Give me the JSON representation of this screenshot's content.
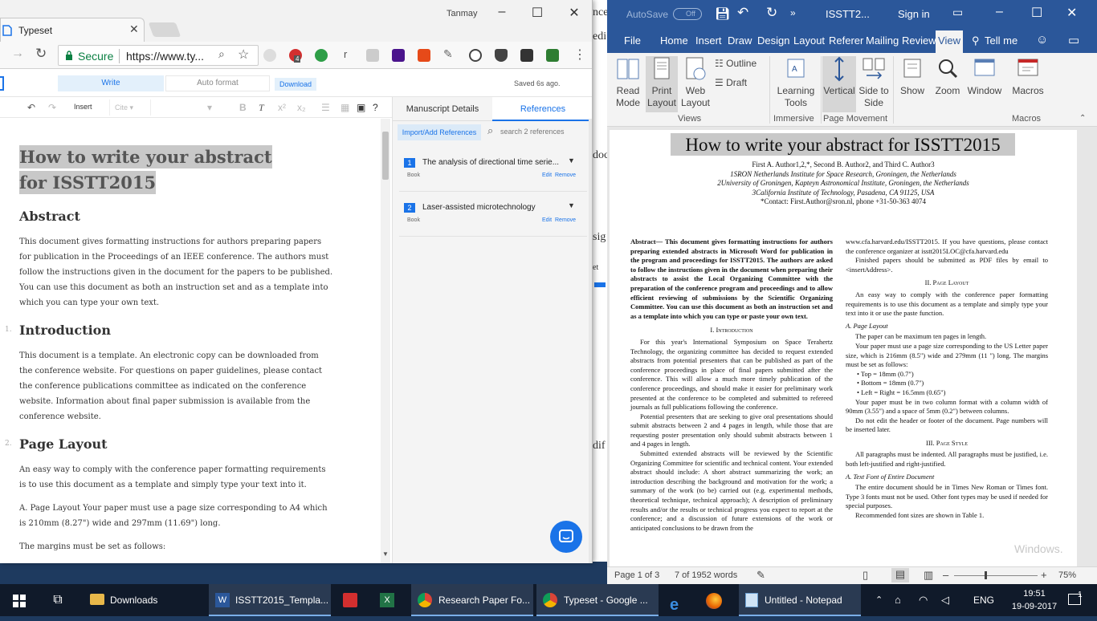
{
  "bg_window": {
    "fragments": [
      "nce",
      "edi",
      "doc",
      "sig",
      "et",
      "dif"
    ]
  },
  "chrome": {
    "user": "Tanmay",
    "tab_title": "Typeset",
    "secure_label": "Secure",
    "url": "https://www.ty...",
    "abp_badge": "4",
    "typeset": {
      "write_label": "Write",
      "autoformat_label": "Auto format",
      "download_label": "Download",
      "saved_text": "Saved 6s ago.",
      "insert_label": "Insert",
      "cite_label": "Cite",
      "doc_title": "How to write your abstract for ISSTT2015",
      "sections": [
        {
          "heading": "Abstract",
          "num": "",
          "paragraphs": [
            "This document gives formatting instructions for authors preparing papers for publication in the Proceedings of an IEEE conference. The authors must follow the instructions given in the document for the papers to be published. You can use this document as both an instruction set and as a template into which you can type your own text."
          ]
        },
        {
          "heading": "Introduction",
          "num": "1.",
          "paragraphs": [
            "This document is a template. An electronic copy can be downloaded from the conference website. For questions on paper guidelines, please contact the conference publications committee as indicated on the conference website. Information about final paper submission is available from the conference website."
          ]
        },
        {
          "heading": "Page Layout",
          "num": "2.",
          "paragraphs": [
            "An easy way to comply with the conference paper formatting requirements is to use this document as a template and simply type your text into it.",
            "A. Page Layout Your paper must use a page size corresponding to A4 which is 210mm (8.27\") wide and 297mm (11.69\") long.",
            "The margins must be set as follows:"
          ]
        }
      ],
      "panel": {
        "tab_manuscript": "Manuscript Details",
        "tab_references": "References",
        "import_label": "Import/Add References",
        "search_placeholder": "search 2 references",
        "refs": [
          {
            "num": "1",
            "title": "The analysis of directional time serie...",
            "type": "Book",
            "edit": "Edit",
            "remove": "Remove"
          },
          {
            "num": "2",
            "title": "Laser-assisted microtechnology",
            "type": "Book",
            "edit": "Edit",
            "remove": "Remove"
          }
        ]
      }
    }
  },
  "word": {
    "autosave_label": "AutoSave",
    "autosave_state": "Off",
    "title": "ISSTT2...",
    "signin": "Sign in",
    "tabs": [
      "File",
      "Home",
      "Insert",
      "Draw",
      "Design",
      "Layout",
      "Referer",
      "Mailing",
      "Review",
      "View"
    ],
    "tell_me": "Tell me",
    "ribbon": {
      "read_mode": "Read Mode",
      "print_layout": "Print Layout",
      "web_layout": "Web Layout",
      "outline": "Outline",
      "draft": "Draft",
      "views_group": "Views",
      "learning_tools": "Learning Tools",
      "immersive_group": "Immersive",
      "vertical": "Vertical",
      "side_to_side": "Side to Side",
      "page_movement_group": "Page Movement",
      "show": "Show",
      "zoom": "Zoom",
      "window": "Window",
      "macros": "Macros",
      "macros_group": "Macros"
    },
    "doc": {
      "title": "How to write your abstract for ISSTT2015",
      "authors": "First A. Author1,2,*, Second B. Author2, and Third C. Author3",
      "aff1": "1SRON Netherlands Institute for Space Research, Groningen, the Netherlands",
      "aff2": "2University of Groningen, Kapteyn Astronomical Institute, Groningen, the Netherlands",
      "aff3": "3California Institute of Technology, Pasadena, CA 91125, USA",
      "contact": "*Contact: First.Author@sron.nl, phone +31-50-363 4074",
      "left_col": [
        "Abstract— This document gives formatting instructions for authors preparing extended abstracts in Microsoft Word for publication in the program and proceedings for ISSTT2015. The authors are asked to follow the instructions given in the document when preparing their abstracts to assist the Local Organizing Committee with the preparation of the conference program and proceedings and to allow efficient reviewing of submissions by the Scientific Organizing Committee. You can use this document as both an instruction set and as a template into which you can type or paste your own text.",
        "I. Introduction",
        "For this year's International Symposium on Space Terahertz Technology, the organizing committee has decided to request extended abstracts from potential presenters that can be published as part of the conference proceedings in place of final papers submitted after the conference. This will allow a much more timely publication of the conference proceedings, and should make it easier for preliminary work presented at the conference to be completed and submitted to refereed journals as full publications following the conference.",
        "Potential presenters that are seeking to give oral presentations should submit abstracts between 2 and 4 pages in length, while those that are requesting poster presentation only should submit abstracts between 1 and 4 pages in length.",
        "Submitted extended abstracts will be reviewed by the Scientific Organizing Committee for scientific and technical content. Your extended abstract should include: A short abstract summarizing the work; an introduction describing the background and motivation for the work; a summary of the work (to be) carried out (e.g. experimental methods, theoretical technique, technical approach); A description of preliminary results and/or the results or technical progress you expect to report at the conference; and a discussion of future extensions of the work or anticipated conclusions to be drawn from the"
      ],
      "right_col": [
        "www.cfa.harvard.edu/ISSTT2015. If you have questions, please contact the conference organizer at isstt2015LOC@cfa.harvard.edu",
        "Finished papers should be submitted as PDF files by email to <insertAddress>.",
        "II. Page Layout",
        "An easy way to comply with the conference paper formatting requirements is to use this document as a template and simply type your text into it or use the paste function.",
        "A. Page Layout",
        "The paper can be maximum ten pages in length.",
        "Your paper must use a page size corresponding to the US Letter paper size, which is 216mm (8.5\") wide and 279mm (11 \") long. The margins must be set as follows:",
        "• Top = 18mm (0.7\")",
        "• Bottom = 18mm (0.7\")",
        "• Left = Right = 16.5mm (0.65\")",
        "Your paper must be in two column format with a column width of 90mm (3.55\") and a space of 5mm (0.2\") between columns.",
        "Do not edit the header or footer of the document. Page numbers will be inserted later.",
        "III. Page Style",
        "All paragraphs must be indented. All paragraphs must be justified, i.e. both left-justified and right-justified.",
        "A. Text Font of Entire Document",
        "The entire document should be in Times New Roman or Times font. Type 3 fonts must not be used. Other font types may be used if needed for special purposes.",
        "Recommended font sizes are shown in Table 1."
      ],
      "watermark": "Windows."
    },
    "status": {
      "page": "Page 1 of 3",
      "words": "7 of 1952 words",
      "zoom": "75%"
    }
  },
  "taskbar": {
    "items": [
      "Downloads",
      "ISSTT2015_Templa...",
      "Research Paper Fo...",
      "Typeset - Google ...",
      "Untitled - Notepad"
    ],
    "lang": "ENG",
    "time": "19:51",
    "date": "19-09-2017",
    "notif": "1"
  }
}
